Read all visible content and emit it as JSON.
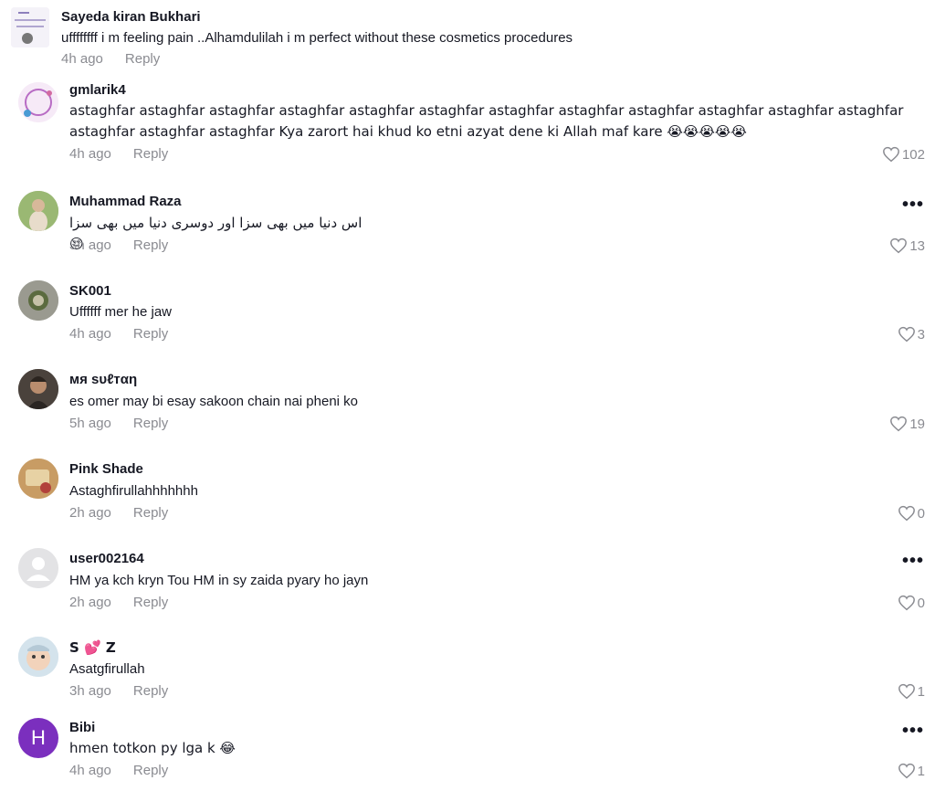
{
  "comments": [
    {
      "name": "Sayeda kiran Bukhari",
      "text": "uffffffff i m feeling pain ..Alhamdulilah i m perfect without these cosmetics procedures",
      "time": "4h ago",
      "reply": "Reply",
      "likes": ""
    },
    {
      "name": "gmlarik4",
      "text": "astaghfar astaghfar astaghfar astaghfar astaghfar astaghfar astaghfar astaghfar astaghfar astaghfar astaghfar astaghfar astaghfar astaghfar astaghfar Kya zarort hai khud ko etni azyat dene ki Allah maf kare 😭😭😭😭😭",
      "time": "4h ago",
      "reply": "Reply",
      "likes": "102"
    },
    {
      "name": "Muhammad Raza",
      "text": "اس دنیا میں بھی سزا اور دوسری دنیا میں بھی سزا 😔",
      "time": "3h ago",
      "reply": "Reply",
      "likes": "13"
    },
    {
      "name": "SK001",
      "text": "Uffffff mer he jaw",
      "time": "4h ago",
      "reply": "Reply",
      "likes": "3"
    },
    {
      "name": "мя ѕυℓтαη",
      "text": "es omer may bi esay sakoon chain nai pheni ko",
      "time": "5h ago",
      "reply": "Reply",
      "likes": "19"
    },
    {
      "name": "Pink Shade",
      "text": "Astaghfirullahhhhhhh",
      "time": "2h ago",
      "reply": "Reply",
      "likes": "0"
    },
    {
      "name": "user002164",
      "text": "HM ya kch kryn Tou HM in sy zaida pyary ho jayn",
      "time": "2h ago",
      "reply": "Reply",
      "likes": "0"
    },
    {
      "name": "S 💕 Z",
      "text": "Asatgfirullah",
      "time": "3h ago",
      "reply": "Reply",
      "likes": "1"
    },
    {
      "name": "Bibi",
      "text": "hmen totkon py lga k 😂",
      "time": "4h ago",
      "reply": "Reply",
      "likes": "1",
      "avatar_letter": "H"
    }
  ],
  "more_label": "•••",
  "colors": {
    "text": "#161823",
    "muted": "#8a8b91",
    "avatar_purple": "#7b2fbe"
  }
}
